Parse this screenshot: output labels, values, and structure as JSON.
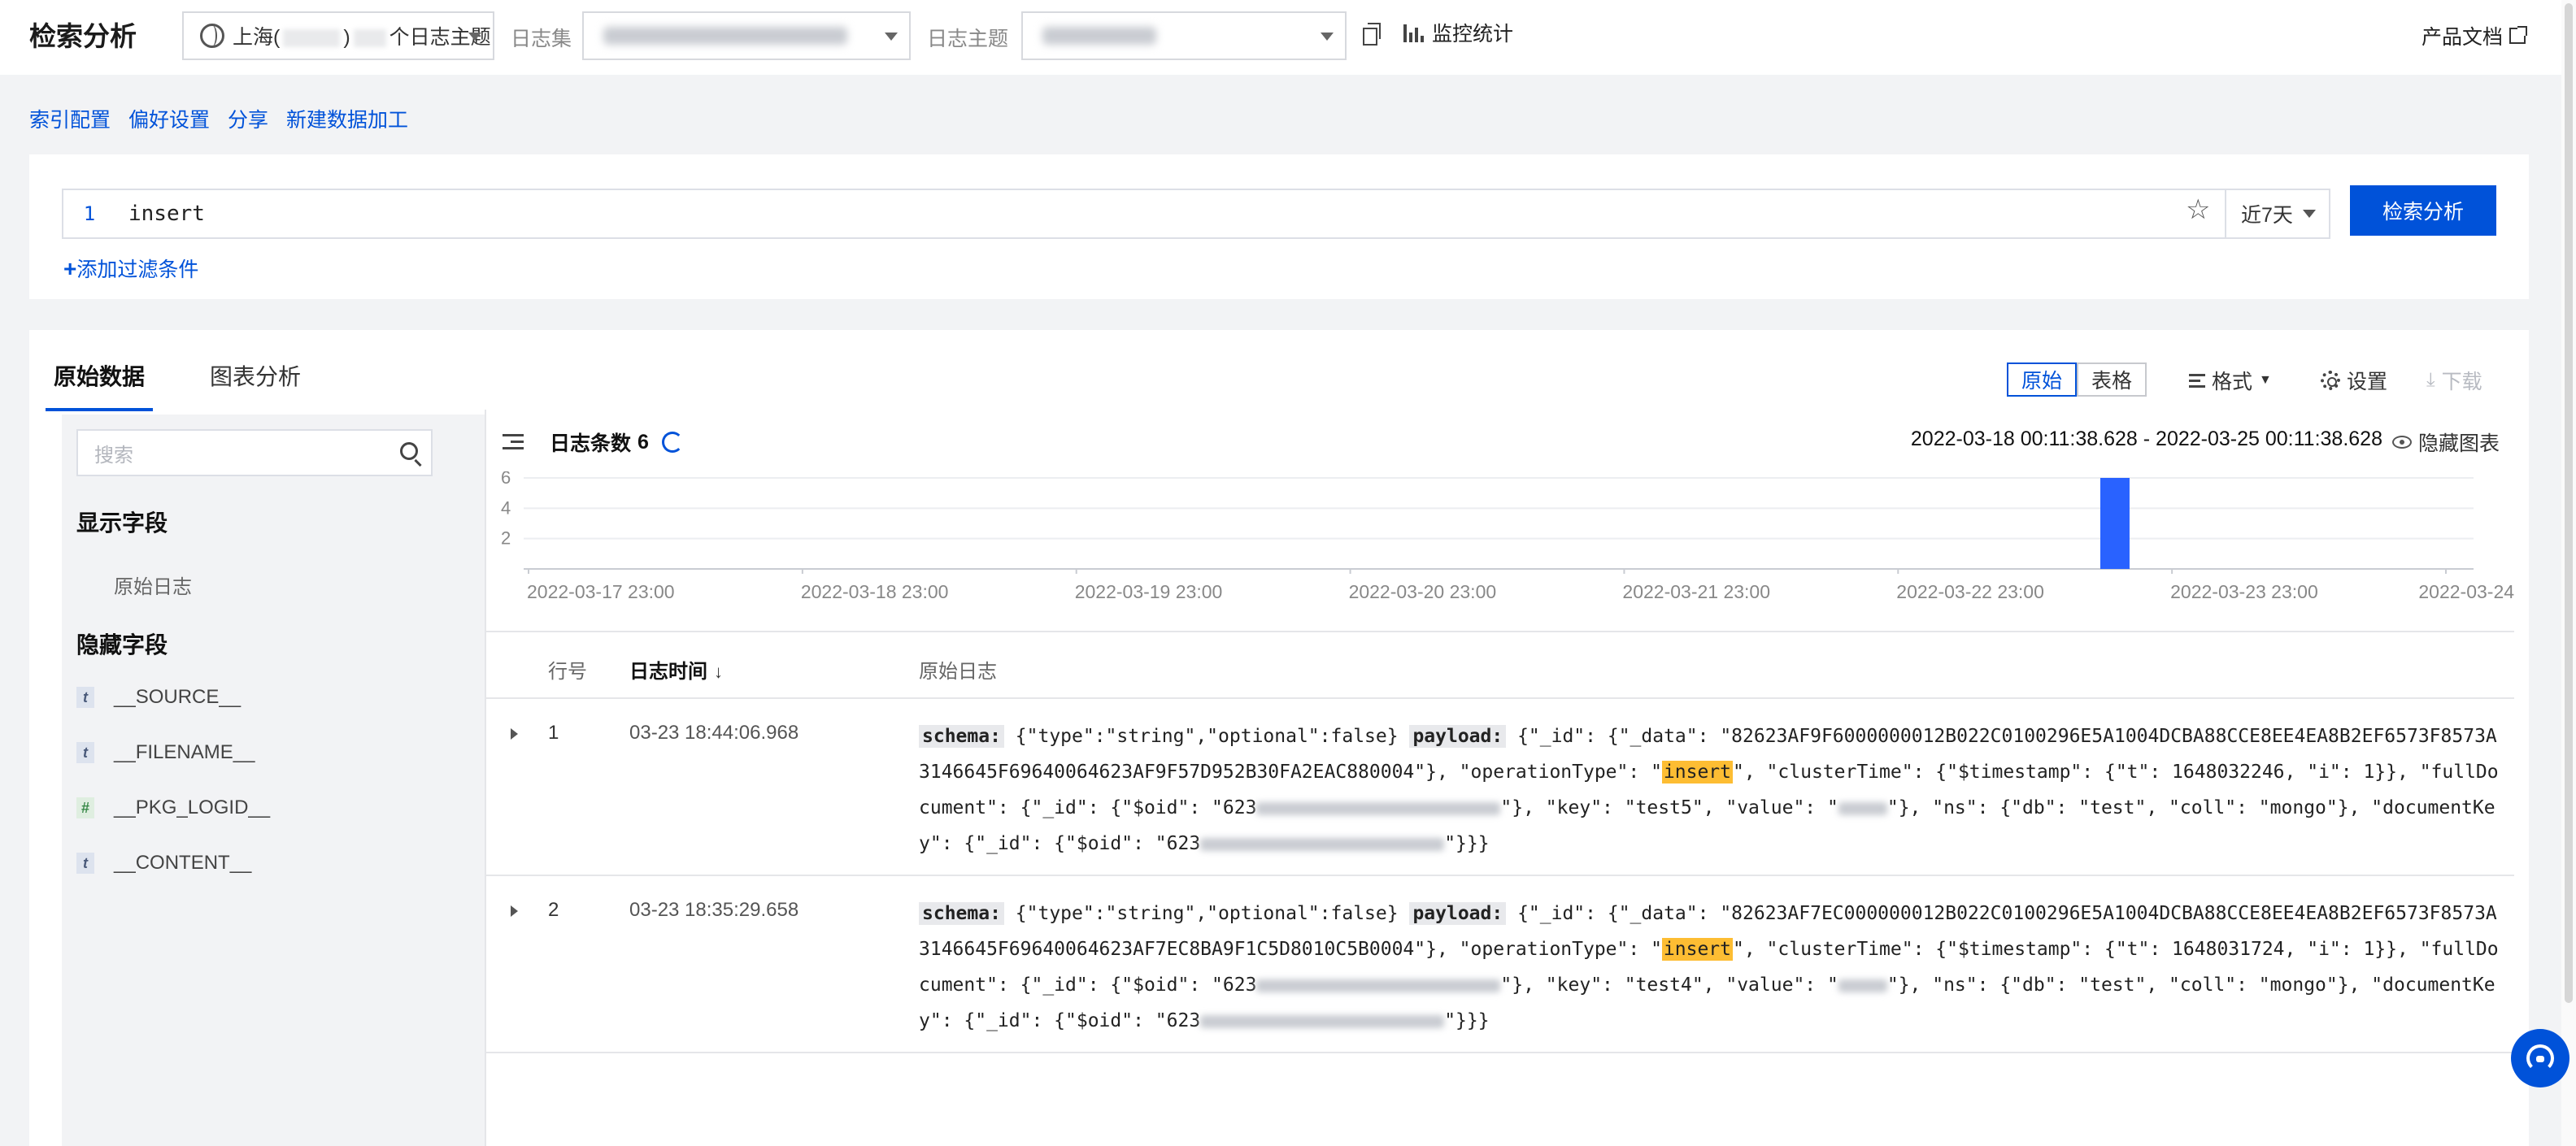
{
  "header": {
    "title": "检索分析",
    "region_prefix": "上海(",
    "region_suffix": ")",
    "region_label": "个日志主题",
    "logset_label": "日志集",
    "topic_label": "日志主题",
    "monitor_label": "监控统计",
    "docs_label": "产品文档"
  },
  "links": [
    "索引配置",
    "偏好设置",
    "分享",
    "新建数据加工"
  ],
  "query": {
    "line_number": "1",
    "text": "insert",
    "time_range": "近7天",
    "search_button": "检索分析",
    "add_filter": "添加过滤条件"
  },
  "results": {
    "tabs": [
      "原始数据",
      "图表分析"
    ],
    "view_modes": [
      "原始",
      "表格"
    ],
    "format_label": "格式",
    "settings_label": "设置",
    "download_label": "下载"
  },
  "sidebar": {
    "search_placeholder": "搜索",
    "shown_fields_title": "显示字段",
    "raw_log_field": "原始日志",
    "hidden_fields_title": "隐藏字段",
    "hidden_fields": [
      {
        "type": "t",
        "name": "__SOURCE__"
      },
      {
        "type": "t",
        "name": "__FILENAME__"
      },
      {
        "type": "#",
        "name": "__PKG_LOGID__"
      },
      {
        "type": "t",
        "name": "__CONTENT__"
      }
    ]
  },
  "chart_header": {
    "count_label": "日志条数",
    "count_value": "6",
    "range": "2022-03-18 00:11:38.628 - 2022-03-25 00:11:38.628",
    "hide_chart_label": "隐藏图表"
  },
  "chart_data": {
    "type": "bar",
    "x_ticks": [
      "2022-03-17 23:00",
      "2022-03-18 23:00",
      "2022-03-19 23:00",
      "2022-03-20 23:00",
      "2022-03-21 23:00",
      "2022-03-22 23:00",
      "2022-03-23 23:00",
      "2022-03-24 23:00"
    ],
    "y_ticks": [
      2,
      4,
      6
    ],
    "ylim": [
      0,
      6
    ],
    "bars": [
      {
        "x": "2022-03-23 18:00",
        "value": 6
      }
    ],
    "bar_color": "#2962ff",
    "grid": true
  },
  "table": {
    "columns": [
      "行号",
      "日志时间",
      "原始日志"
    ],
    "rows": [
      {
        "num": "1",
        "time": "03-23 18:44:06.968",
        "schema_tag": "schema:",
        "schema_text": " {\"type\":\"string\",\"optional\":false} ",
        "payload_tag": "payload:",
        "part1": " {\"_id\": {\"_data\": \"82623AF9F6000000012B022C0100296E5A1004DCBA88CCE8EE4EA8B2EF6573F8573A3146645F69640064623AF9F57D952B30FA2EAC880004\"}, \"operationType\": \"",
        "highlight": "insert",
        "part2": "\", \"clusterTime\": {\"$timestamp\": {\"t\": 1648032246, \"i\": 1}}, \"fullDocument\": {\"_id\": {\"$oid\": \"623",
        "part3": "\"}, \"key\": \"test5\", \"value\": \"",
        "part4": "\"}, \"ns\": {\"db\": \"test\", \"coll\": \"mongo\"}, \"documentKey\": {\"_id\": {\"$oid\": \"623",
        "part5": "\"}}}"
      },
      {
        "num": "2",
        "time": "03-23 18:35:29.658",
        "schema_tag": "schema:",
        "schema_text": " {\"type\":\"string\",\"optional\":false} ",
        "payload_tag": "payload:",
        "part1": " {\"_id\": {\"_data\": \"82623AF7EC000000012B022C0100296E5A1004DCBA88CCE8EE4EA8B2EF6573F8573A3146645F69640064623AF7EC8BA9F1C5D8010C5B0004\"}, \"operationType\": \"",
        "highlight": "insert",
        "part2": "\", \"clusterTime\": {\"$timestamp\": {\"t\": 1648031724, \"i\": 1}}, \"fullDocument\": {\"_id\": {\"$oid\": \"623",
        "part3": "\"}, \"key\": \"test4\", \"value\": \"",
        "part4": "\"}, \"ns\": {\"db\": \"test\", \"coll\": \"mongo\"}, \"documentKey\": {\"_id\": {\"$oid\": \"623",
        "part5": "\"}}}"
      }
    ]
  }
}
